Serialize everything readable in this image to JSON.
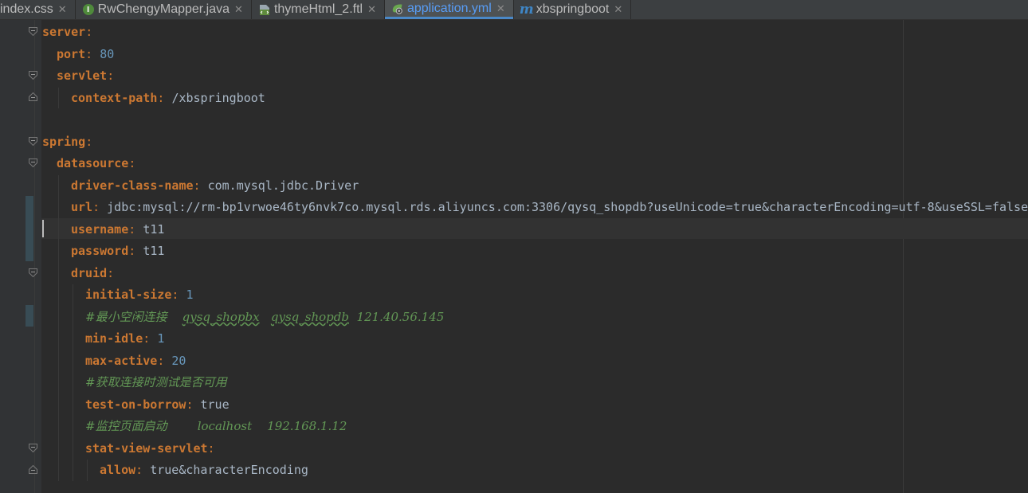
{
  "tabs": [
    {
      "label": "index.css",
      "icon": "css-file-icon",
      "active": false
    },
    {
      "label": "RwChengyMapper.java",
      "icon": "java-interface-icon",
      "active": false
    },
    {
      "label": "thymeHtml_2.ftl",
      "icon": "ftl-file-icon",
      "active": false
    },
    {
      "label": "application.yml",
      "icon": "spring-yml-icon",
      "active": true
    },
    {
      "label": "xbspringboot",
      "icon": "maven-m-icon",
      "active": false
    }
  ],
  "close_glyph": "✕",
  "java_icon_letter": "I",
  "maven_icon_letter": "m",
  "code": {
    "server_key": "server",
    "port_key": "port",
    "port_val": "80",
    "servlet_key": "servlet",
    "context_path_key": "context-path",
    "context_path_val": "/xbspringboot",
    "spring_key": "spring",
    "datasource_key": "datasource",
    "driver_key": "driver-class-name",
    "driver_val": "com.mysql.jdbc.Driver",
    "url_key": "url",
    "url_val": "jdbc:mysql://rm-bp1vrwoe46ty6nvk7co.mysql.rds.aliyuncs.com:3306/qysq_shopdb?useUnicode=true&characterEncoding=utf-8&useSSL=false",
    "username_key": "username",
    "username_val": "t11",
    "password_key": "password",
    "password_val": "t11",
    "druid_key": "druid",
    "initial_size_key": "initial-size",
    "initial_size_val": "1",
    "comment1_prefix": "#最小空闲连接    ",
    "comment1_u1": "qysq_shopbx",
    "comment1_gap": "   ",
    "comment1_u2": "qysq_shopdb",
    "comment1_tail": "  121.40.56.145",
    "min_idle_key": "min-idle",
    "min_idle_val": "1",
    "max_active_key": "max-active",
    "max_active_val": "20",
    "comment2": "#获取连接时测试是否可用",
    "test_on_borrow_key": "test-on-borrow",
    "test_on_borrow_val": "true",
    "comment3": "#监控页面启动        localhost    192.168.1.12",
    "stat_view_key": "stat-view-servlet",
    "allow_key": "allow",
    "allow_val": "true&characterEncoding"
  },
  "colors": {
    "background": "#2b2b2b",
    "gutter": "#313335",
    "key": "#cc7832",
    "number": "#6897bb",
    "string": "#a9b7c6",
    "comment": "#629755",
    "active_tab_text": "#589df6"
  }
}
